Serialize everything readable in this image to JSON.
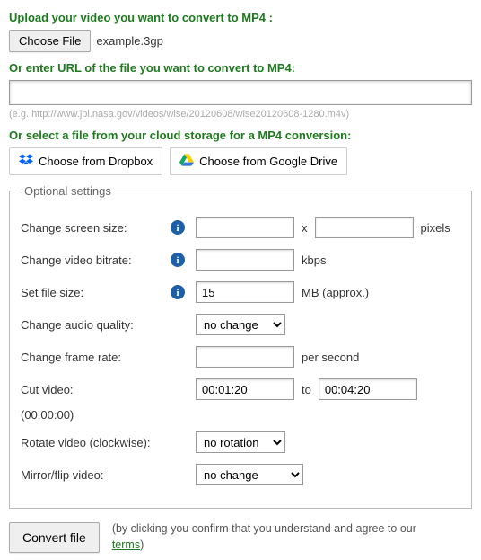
{
  "upload": {
    "heading": "Upload your video you want to convert to MP4 :",
    "choose_file_label": "Choose File",
    "selected_filename": "example.3gp"
  },
  "url_section": {
    "heading": "Or enter URL of the file you want to convert to MP4:",
    "value": "",
    "hint": "(e.g. http://www.jpl.nasa.gov/videos/wise/20120608/wise20120608-1280.m4v)"
  },
  "cloud": {
    "heading": "Or select a file from your cloud storage for a MP4 conversion:",
    "dropbox_label": "Choose from Dropbox",
    "gdrive_label": "Choose from Google Drive"
  },
  "settings": {
    "legend": "Optional settings",
    "screen_size": {
      "label": "Change screen size:",
      "w": "",
      "h": "",
      "sep": "x",
      "unit": "pixels"
    },
    "bitrate": {
      "label": "Change video bitrate:",
      "value": "",
      "unit": "kbps"
    },
    "file_size": {
      "label": "Set file size:",
      "value": "15",
      "unit": "MB (approx.)"
    },
    "audio_quality": {
      "label": "Change audio quality:",
      "value": "no change"
    },
    "frame_rate": {
      "label": "Change frame rate:",
      "value": "",
      "unit": "per second"
    },
    "cut": {
      "label": "Cut video:",
      "from": "00:01:20",
      "to_label": "to",
      "to": "00:04:20",
      "format_note": "(00:00:00)"
    },
    "rotate": {
      "label": "Rotate video (clockwise):",
      "value": "no rotation"
    },
    "mirror": {
      "label": "Mirror/flip video:",
      "value": "no change"
    }
  },
  "submit": {
    "button_label": "Convert file",
    "agree_prefix": "(by clicking you confirm that you understand and agree to our ",
    "agree_link": "terms",
    "agree_suffix": ")"
  }
}
